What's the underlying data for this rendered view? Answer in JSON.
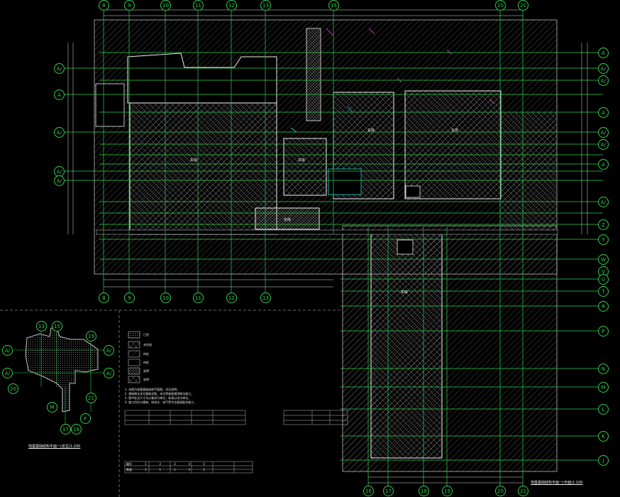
{
  "colors": {
    "grid": "#2fd24a",
    "wall": "#ffffff",
    "cyan": "#25d0d0",
    "magenta": "#e24fe2",
    "hatch": "#8a8a8a",
    "bg": "#000000"
  },
  "grid_top": [
    "8",
    "9",
    "10",
    "11",
    "12",
    "13",
    "15",
    "20",
    "21"
  ],
  "grid_bottom": [
    "8",
    "9",
    "10",
    "11",
    "12",
    "13"
  ],
  "grid_bottom2": [
    "16",
    "17",
    "18",
    "19",
    "20",
    "21"
  ],
  "grid_right": [
    "A",
    "A/",
    "A/",
    "A",
    "A/",
    "A/",
    "A",
    "A/",
    "Z",
    "Y",
    "W",
    "V",
    "U",
    "T",
    "R",
    "P",
    "N",
    "M",
    "L",
    "K",
    "J"
  ],
  "grid_left": [
    "A/",
    "A",
    "A/",
    "A/",
    "A/"
  ],
  "room_labels": [
    "车库",
    "车库",
    "车库",
    "车库",
    "车库",
    "车库"
  ],
  "titles": {
    "main": "地基基础结构平面一(平面)1:100",
    "key": "地基基础结构平面一(定位)1:200"
  },
  "key_bubbles": [
    "13",
    "15",
    "A/",
    "A/",
    "A/",
    "A/",
    "19",
    "20",
    "21",
    "M",
    "F",
    "17",
    "18"
  ],
  "legend": [
    {
      "label": "已完"
    },
    {
      "label": "未完成"
    },
    {
      "label": "待定"
    },
    {
      "label": "待定"
    },
    {
      "label": "说明"
    },
    {
      "label": "说明"
    }
  ],
  "notes": [
    "1. 本图为地基基础结构平面图，详见说明。",
    "2. 基础做法详见基础详图，未注明者按通用做法施工。",
    "3. 图中标注尺寸均以毫米为单位，标高以米为单位。",
    "4. 施工时应与建筑、给排水、电气等专业图纸配合施工。"
  ],
  "table_rows": [
    [
      "编号",
      "1",
      "2",
      "3",
      "4",
      "5",
      "6",
      "7",
      "8"
    ],
    [
      "数量",
      "1",
      "1",
      "1",
      "1",
      "1",
      "1",
      "1",
      "1"
    ]
  ]
}
